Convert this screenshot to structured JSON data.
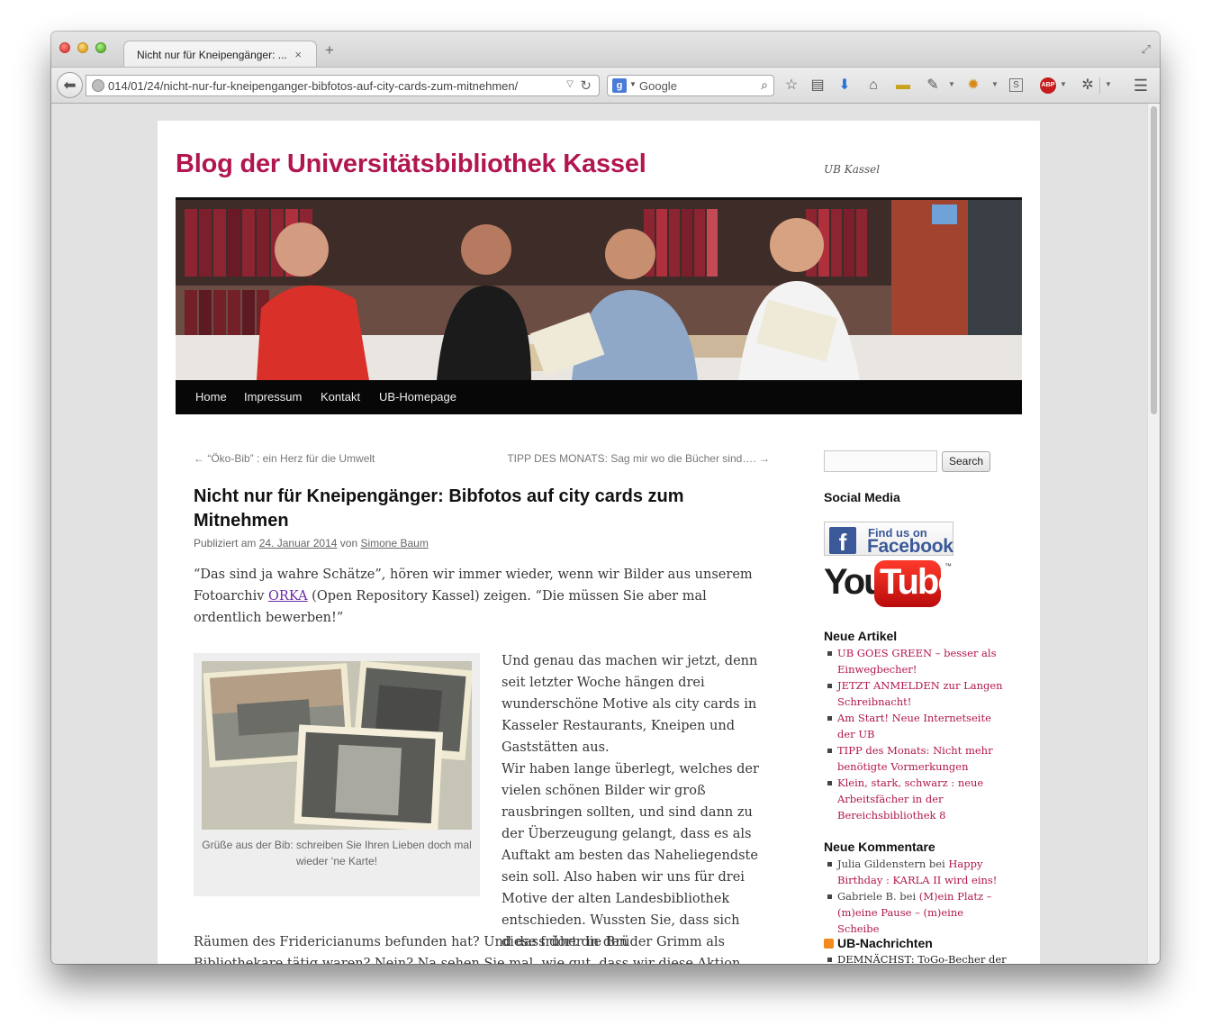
{
  "browser": {
    "tab_title": "Nicht nur für Kneipengänger: ...",
    "tab_close": "×",
    "new_tab": "+",
    "url": "014/01/24/nicht-nur-fur-kneipenganger-bibfotos-auf-city-cards-zum-mitnehmen/",
    "search_engine": "Google",
    "search_engine_logo": "g",
    "icons": [
      "back-arrow-icon",
      "globe-icon",
      "reload-icon",
      "google-icon",
      "magnifier-icon",
      "bookmark-star-icon",
      "clipboard-icon",
      "download-icon",
      "home-icon",
      "ruler-icon",
      "eyedropper-icon",
      "firebug-icon",
      "screenshot-icon",
      "adblock-icon",
      "bug-icon",
      "menu-icon"
    ],
    "adblock_label": "ABP"
  },
  "site": {
    "title": "Blog der Universitätsbibliothek Kassel",
    "description": "UB Kassel",
    "menu": [
      "Home",
      "Impressum",
      "Kontakt",
      "UB-Homepage"
    ]
  },
  "post": {
    "prev_link": "← “Öko-Bib” : ein Herz für die Umwelt",
    "next_link": "TIPP DES MONATS: Sag mir wo die Bücher sind…. →",
    "title": "Nicht nur für Kneipengänger: Bibfotos auf city cards zum Mitnehmen",
    "meta_prefix": "Publiziert am ",
    "meta_date": "24. Januar 2014",
    "meta_by": " von ",
    "meta_author": "Simone Baum",
    "intro_1": "“Das sind ja wahre Schätze”, hören wir immer wieder, wenn wir Bilder aus unserem Fotoarchiv ",
    "intro_link": "ORKA",
    "intro_2": " (Open Repository Kassel) zeigen. “Die müssen Sie aber mal ordentlich bewerben!”",
    "body_1": "Und genau das machen wir jetzt, denn seit letzter Woche hängen drei wunderschöne Motive als city cards in Kasseler Restaurants, Kneipen und Gaststätten aus.",
    "body_2": "Wir haben lange überlegt, welches der vielen schönen Bilder wir groß rausbringen sollten, und sind dann zu der Überzeugung gelangt, dass es als Auftakt am besten das Naheliegendste sein soll. Also haben wir uns für drei Motive der alten Landesbibliothek entschieden. Wussten Sie, dass sich diese früher in den",
    "body_3": "Räumen des Fridericianums befunden hat? Und dass dort die Brüder Grimm als Bibliothekare tätig waren? Nein? Na sehen Sie mal, wie gut, dass wir diese Aktion",
    "figure_caption": "Grüße aus der Bib: schreiben Sie Ihren Lieben doch mal wieder ‘ne Karte!"
  },
  "sidebar": {
    "search_value": "",
    "search_button": "Search",
    "social_title": "Social Media",
    "facebook_find": "Find us on",
    "facebook_name": "Facebook",
    "facebook_letter": "f",
    "youtube_you": "You",
    "youtube_tube": "Tube",
    "youtube_tm": "™",
    "recent_title": "Neue Artikel",
    "recent_posts": [
      "UB GOES GREEN – besser als Einwegbecher!",
      "JETZT ANMELDEN zur Langen Schreibnacht!",
      "Am Start! Neue Internetseite der UB",
      "TIPP des Monats: Nicht mehr benötigte Vormerkungen",
      "Klein, stark, schwarz : neue Arbeitsfächer in der Bereichsbibliothek 8"
    ],
    "comments_title": "Neue Kommentare",
    "comments": [
      {
        "author": "Julia Gildenstern",
        "on": " bei ",
        "post": "Happy Birthday : KARLA II wird eins!"
      },
      {
        "author": "Gabriele B.",
        "on": " bei ",
        "post": "(M)ein Platz – (m)eine Pause – (m)eine Scheibe"
      }
    ],
    "rss_title": "UB-Nachrichten",
    "rss_item": "DEMNÄCHST: ToGo-Becher der"
  }
}
